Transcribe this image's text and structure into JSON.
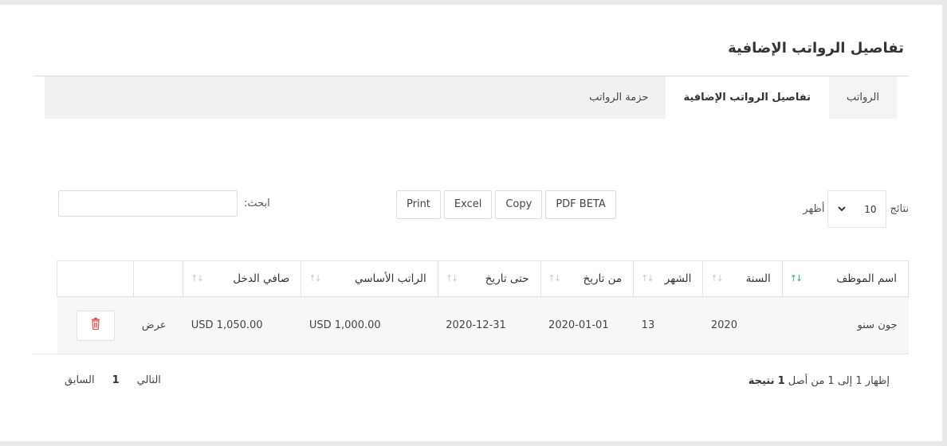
{
  "page": {
    "title": "تفاصيل الرواتب الإضافية"
  },
  "tabs": [
    {
      "label": "الرواتب"
    },
    {
      "label": "تفاصيل الرواتب الإضافية",
      "active": true
    },
    {
      "label": "حزمة الرواتب"
    }
  ],
  "length": {
    "prefix": "أظهر",
    "value": "10",
    "suffix": "نتائج"
  },
  "buttons": {
    "print": "Print",
    "excel": "Excel",
    "copy": "Copy",
    "pdf": "PDF BETA"
  },
  "search": {
    "label": "ابحث:",
    "value": ""
  },
  "table": {
    "headers": [
      "اسم الموظف",
      "السنة",
      "الشهر",
      "من تاريخ",
      "حتى تاريخ",
      "الراتب الأساسي",
      "صافي الدخل",
      "",
      ""
    ],
    "rows": [
      {
        "employee": "جون سنو",
        "year": "2020",
        "month": "13",
        "from": "2020-01-01",
        "to": "2020-12-31",
        "basic": "USD 1,000.00",
        "net": "USD 1,050.00",
        "view": "عرض"
      }
    ]
  },
  "info": {
    "text": "إظهار 1 إلى 1 من أصل",
    "total": "1",
    "unit": "نتيجة"
  },
  "pager": {
    "prev": "السابق",
    "page": "1",
    "next": "التالي"
  },
  "colors": {
    "accent": "#3aa686",
    "danger": "#e05c5c"
  },
  "icons": {
    "delete": "trash-icon",
    "sort": "sort-arrows-icon",
    "select": "chevron-down-icon"
  }
}
